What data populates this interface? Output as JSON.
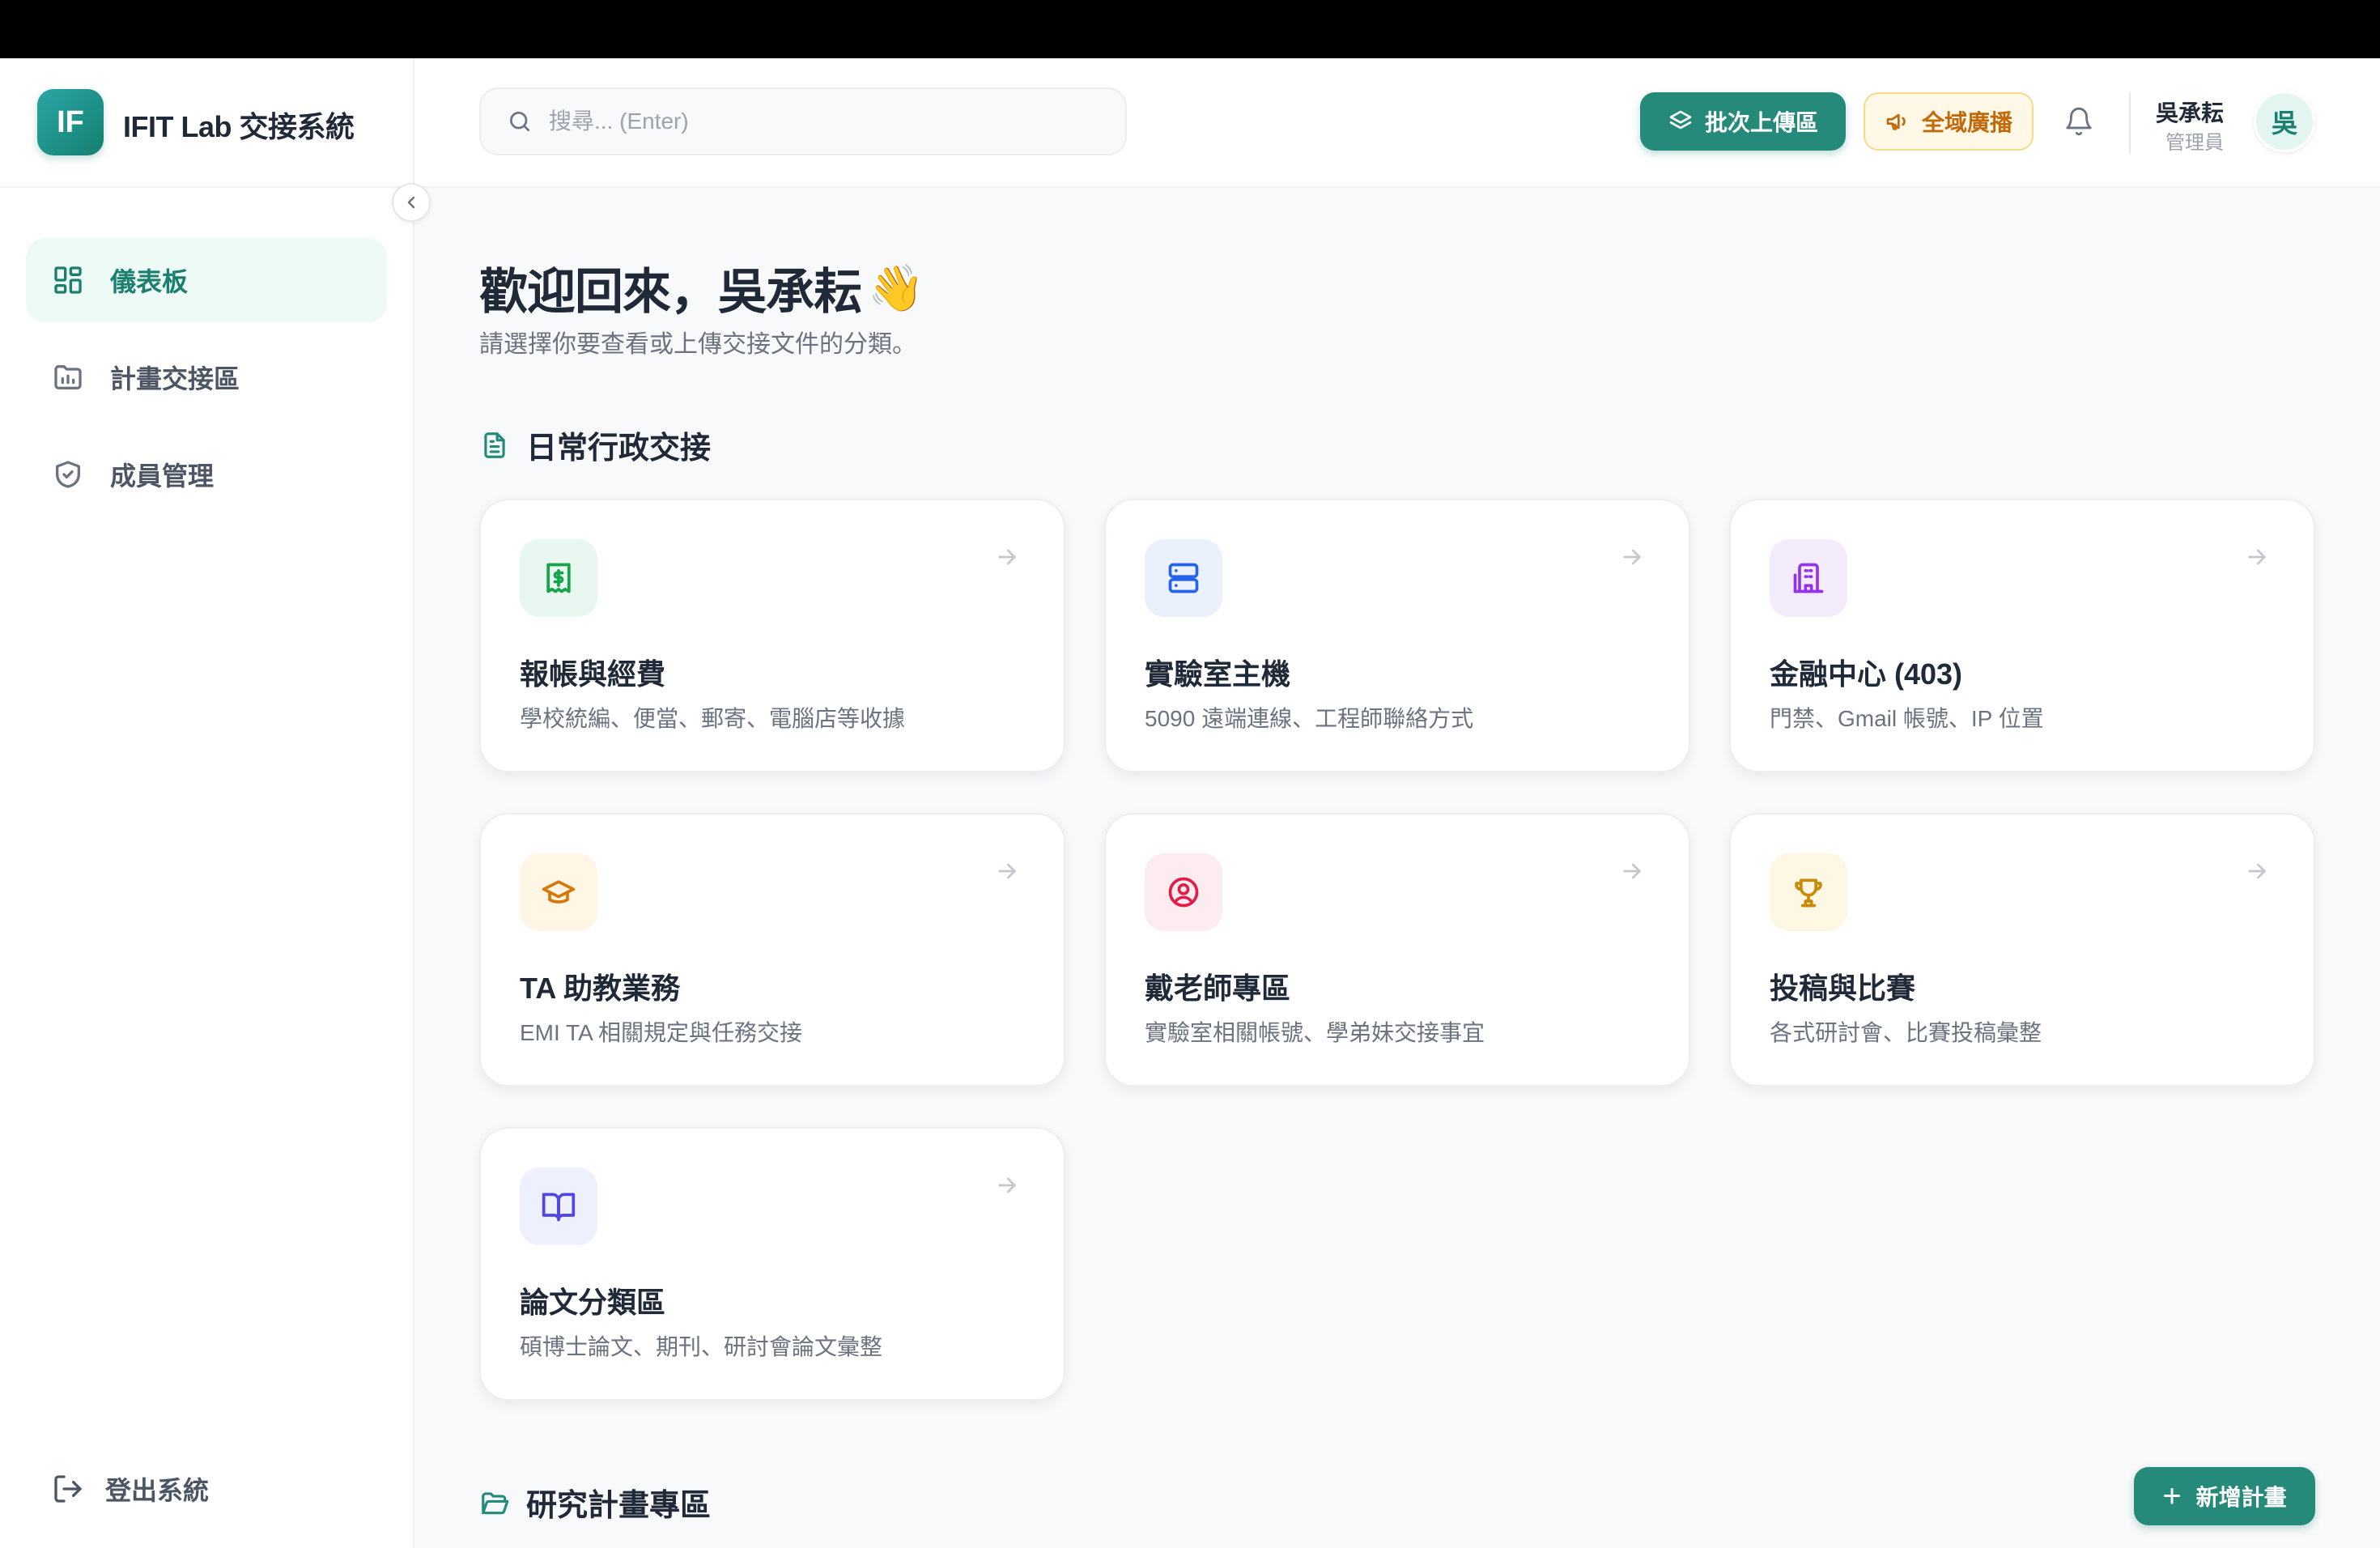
{
  "brand": {
    "logo_text": "IF",
    "title": "IFIT Lab 交接系統"
  },
  "sidebar": {
    "items": [
      {
        "label": "儀表板",
        "icon": "dashboard-icon",
        "active": true
      },
      {
        "label": "計畫交接區",
        "icon": "folder-chart-icon",
        "active": false
      },
      {
        "label": "成員管理",
        "icon": "shield-check-icon",
        "active": false
      }
    ],
    "logout_label": "登出系統"
  },
  "header": {
    "search_placeholder": "搜尋... (Enter)",
    "batch_upload_label": "批次上傳區",
    "broadcast_label": "全域廣播",
    "user_name": "吳承耘",
    "user_role": "管理員",
    "avatar_text": "吳"
  },
  "main": {
    "welcome": "歡迎回來，吳承耘",
    "welcome_emoji": "👋",
    "subtitle": "請選擇你要查看或上傳交接文件的分類。",
    "section_daily": "日常行政交接",
    "section_research": "研究計畫專區",
    "add_plan_label": "新增計畫",
    "cards": [
      {
        "title": "報帳與經費",
        "desc": "學校統編、便當、郵寄、電腦店等收據",
        "icon": "receipt-icon"
      },
      {
        "title": "實驗室主機",
        "desc": "5090 遠端連線、工程師聯絡方式",
        "icon": "server-icon"
      },
      {
        "title": "金融中心 (403)",
        "desc": "門禁、Gmail 帳號、IP 位置",
        "icon": "building-icon"
      },
      {
        "title": "TA 助教業務",
        "desc": "EMI TA 相關規定與任務交接",
        "icon": "graduation-cap-icon"
      },
      {
        "title": "戴老師專區",
        "desc": "實驗室相關帳號、學弟妹交接事宜",
        "icon": "user-circle-icon"
      },
      {
        "title": "投稿與比賽",
        "desc": "各式研討會、比賽投稿彙整",
        "icon": "trophy-icon"
      },
      {
        "title": "論文分類區",
        "desc": "碩博士論文、期刊、研討會論文彙整",
        "icon": "book-open-icon"
      }
    ]
  },
  "colors": {
    "accent": "#268a7a",
    "broadcast_bg": "#fff8e6",
    "broadcast_text": "#c26a0a"
  }
}
